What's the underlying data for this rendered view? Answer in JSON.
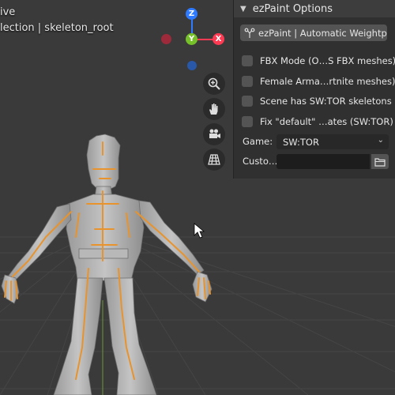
{
  "viewport": {
    "mode_text": "ive",
    "collection_text": "lection | skeleton_root"
  },
  "gizmo": {
    "z_label": "Z",
    "y_label": "Y",
    "x_label": "X",
    "z_color": "#2f7bff",
    "y_color": "#76c02a",
    "x_color": "#ff3b54"
  },
  "tools": [
    "zoom-icon",
    "pan-hand-icon",
    "camera-icon",
    "ortho-grid-icon"
  ],
  "panel": {
    "title": "ezPaint Options",
    "operator_label": "ezPaint | Automatic Weightp…",
    "checkboxes": [
      {
        "label": "FBX Mode (O…S FBX meshes)",
        "checked": false
      },
      {
        "label": "Female Arma…rtnite meshes)",
        "checked": false
      },
      {
        "label": "Scene has SW:TOR skeletons",
        "checked": false
      },
      {
        "label": "Fix \"default\" …ates (SW:TOR)",
        "checked": false
      }
    ],
    "game_label": "Game:",
    "game_value": "SW:TOR",
    "custom_label": "Custo…",
    "custom_value": ""
  }
}
